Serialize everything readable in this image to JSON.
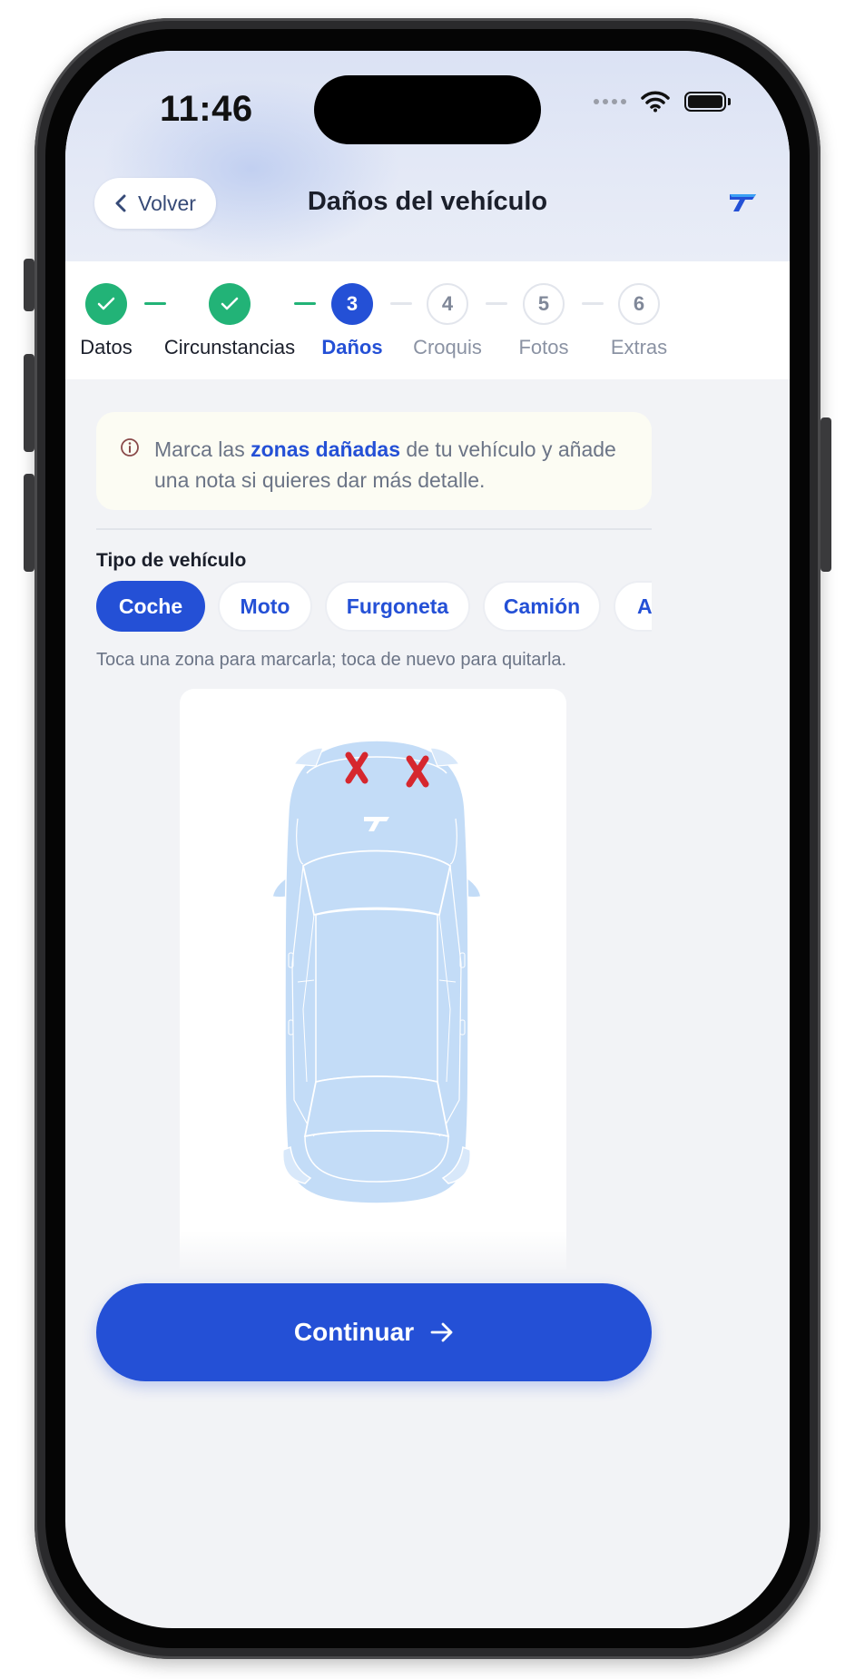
{
  "status": {
    "time": "11:46"
  },
  "header": {
    "back_label": "Volver",
    "title": "Daños del vehículo"
  },
  "stepper": {
    "steps": [
      {
        "number": "1",
        "label": "Datos",
        "state": "done"
      },
      {
        "number": "2",
        "label": "Circunstancias",
        "state": "done"
      },
      {
        "number": "3",
        "label": "Daños",
        "state": "active"
      },
      {
        "number": "4",
        "label": "Croquis",
        "state": "pending"
      },
      {
        "number": "5",
        "label": "Fotos",
        "state": "pending"
      },
      {
        "number": "6",
        "label": "Extras",
        "state": "pending"
      }
    ]
  },
  "info": {
    "text_before": "Marca las ",
    "highlight": "zonas dañadas",
    "text_after": " de tu vehículo y añade una nota si quieres dar más detalle."
  },
  "vehicle_type": {
    "label": "Tipo de vehículo",
    "options": [
      {
        "label": "Coche",
        "selected": true
      },
      {
        "label": "Moto",
        "selected": false
      },
      {
        "label": "Furgoneta",
        "selected": false
      },
      {
        "label": "Camión",
        "selected": false
      },
      {
        "label": "Autobús",
        "selected": false
      }
    ]
  },
  "hint": "Toca una zona para marcarla; toca de nuevo para quitarla.",
  "damage_markers": [
    "front-left",
    "front-right"
  ],
  "continue_label": "Continuar",
  "colors": {
    "primary": "#2450d6",
    "success": "#22b377",
    "info_bg": "#fcfcf3",
    "car_fill": "#c3dcf7",
    "damage_mark": "#d6272e"
  }
}
